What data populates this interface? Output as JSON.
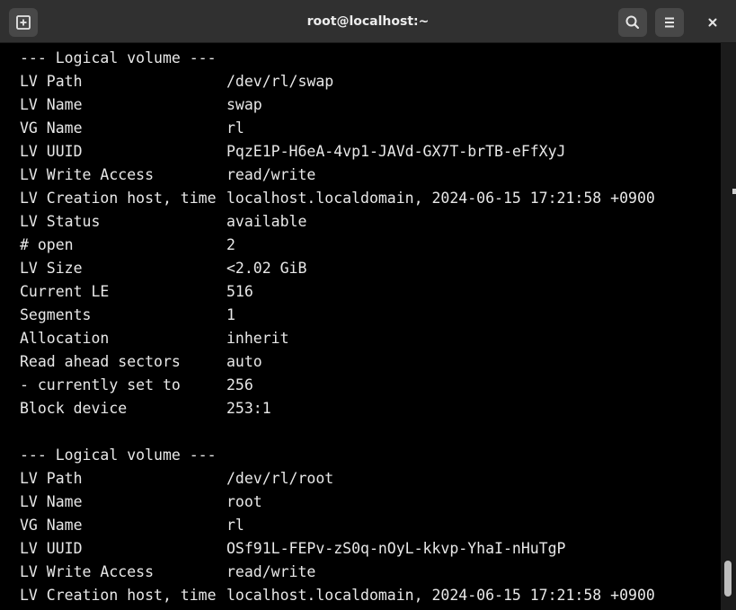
{
  "window": {
    "title": "root@localhost:~"
  },
  "icons": {
    "new_tab": "new-tab-icon",
    "search": "search-icon",
    "menu": "hamburger-menu-icon",
    "close": "close-icon"
  },
  "colors": {
    "titlebar": "#303030",
    "button": "#484848",
    "terminal_bg": "#000000",
    "terminal_fg": "#e8e8e8"
  },
  "terminal": {
    "lines": [
      {
        "key": "--- Logical volume ---",
        "value": ""
      },
      {
        "key": "LV Path",
        "value": "/dev/rl/swap"
      },
      {
        "key": "LV Name",
        "value": "swap"
      },
      {
        "key": "VG Name",
        "value": "rl"
      },
      {
        "key": "LV UUID",
        "value": "PqzE1P-H6eA-4vp1-JAVd-GX7T-brTB-eFfXyJ"
      },
      {
        "key": "LV Write Access",
        "value": "read/write"
      },
      {
        "key": "LV Creation host, time",
        "value": "localhost.localdomain, 2024-06-15 17:21:58 +0900"
      },
      {
        "key": "LV Status",
        "value": "available"
      },
      {
        "key": "# open",
        "value": "2"
      },
      {
        "key": "LV Size",
        "value": "<2.02 GiB"
      },
      {
        "key": "Current LE",
        "value": "516"
      },
      {
        "key": "Segments",
        "value": "1"
      },
      {
        "key": "Allocation",
        "value": "inherit"
      },
      {
        "key": "Read ahead sectors",
        "value": "auto"
      },
      {
        "key": "- currently set to",
        "value": "256"
      },
      {
        "key": "Block device",
        "value": "253:1"
      },
      {
        "key": "",
        "value": ""
      },
      {
        "key": "--- Logical volume ---",
        "value": ""
      },
      {
        "key": "LV Path",
        "value": "/dev/rl/root"
      },
      {
        "key": "LV Name",
        "value": "root"
      },
      {
        "key": "VG Name",
        "value": "rl"
      },
      {
        "key": "LV UUID",
        "value": "OSf91L-FEPv-zS0q-nOyL-kkvp-YhaI-nHuTgP"
      },
      {
        "key": "LV Write Access",
        "value": "read/write"
      },
      {
        "key": "LV Creation host, time",
        "value": "localhost.localdomain, 2024-06-15 17:21:58 +0900"
      }
    ]
  }
}
